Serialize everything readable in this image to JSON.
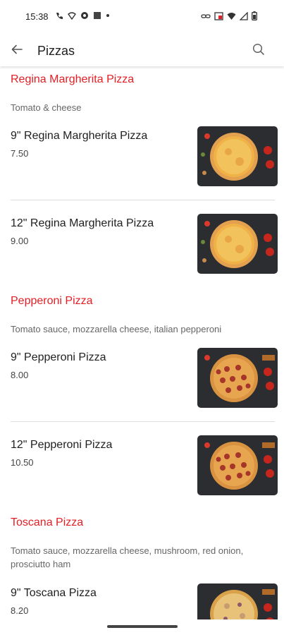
{
  "status_bar": {
    "time": "15:38",
    "left_icons": [
      "wifi-calling-icon",
      "network-icon",
      "sync-icon",
      "square-app-icon",
      "dot-icon"
    ],
    "right_icons": [
      "link-icon",
      "cast-icon",
      "wifi-icon",
      "signal-icon",
      "battery-icon"
    ]
  },
  "app_bar": {
    "title": "Pizzas",
    "back_icon": "arrow-left-icon",
    "search_icon": "search-icon"
  },
  "colors": {
    "accent": "#e31e24",
    "text": "#1f1f1f",
    "muted": "#666666",
    "divider": "#dddddd"
  },
  "categories": [
    {
      "title": "Regina Margherita Pizza",
      "description": "Tomato & cheese",
      "items": [
        {
          "name": "9\" Regina Margherita Pizza",
          "price": "7.50",
          "image": "margherita-pizza-image"
        },
        {
          "name": "12\" Regina Margherita Pizza",
          "price": "9.00",
          "image": "margherita-pizza-image"
        }
      ]
    },
    {
      "title": "Pepperoni Pizza",
      "description": "Tomato sauce, mozzarella cheese, italian pepperoni",
      "items": [
        {
          "name": "9\" Pepperoni Pizza",
          "price": "8.00",
          "image": "pepperoni-pizza-image"
        },
        {
          "name": "12\" Pepperoni Pizza",
          "price": "10.50",
          "image": "pepperoni-pizza-image"
        }
      ]
    },
    {
      "title": "Toscana Pizza",
      "description": "Tomato sauce, mozzarella cheese, mushroom, red onion, prosciutto ham",
      "items": [
        {
          "name": "9\" Toscana Pizza",
          "price": "8.20",
          "image": "toscana-pizza-image"
        }
      ]
    }
  ]
}
